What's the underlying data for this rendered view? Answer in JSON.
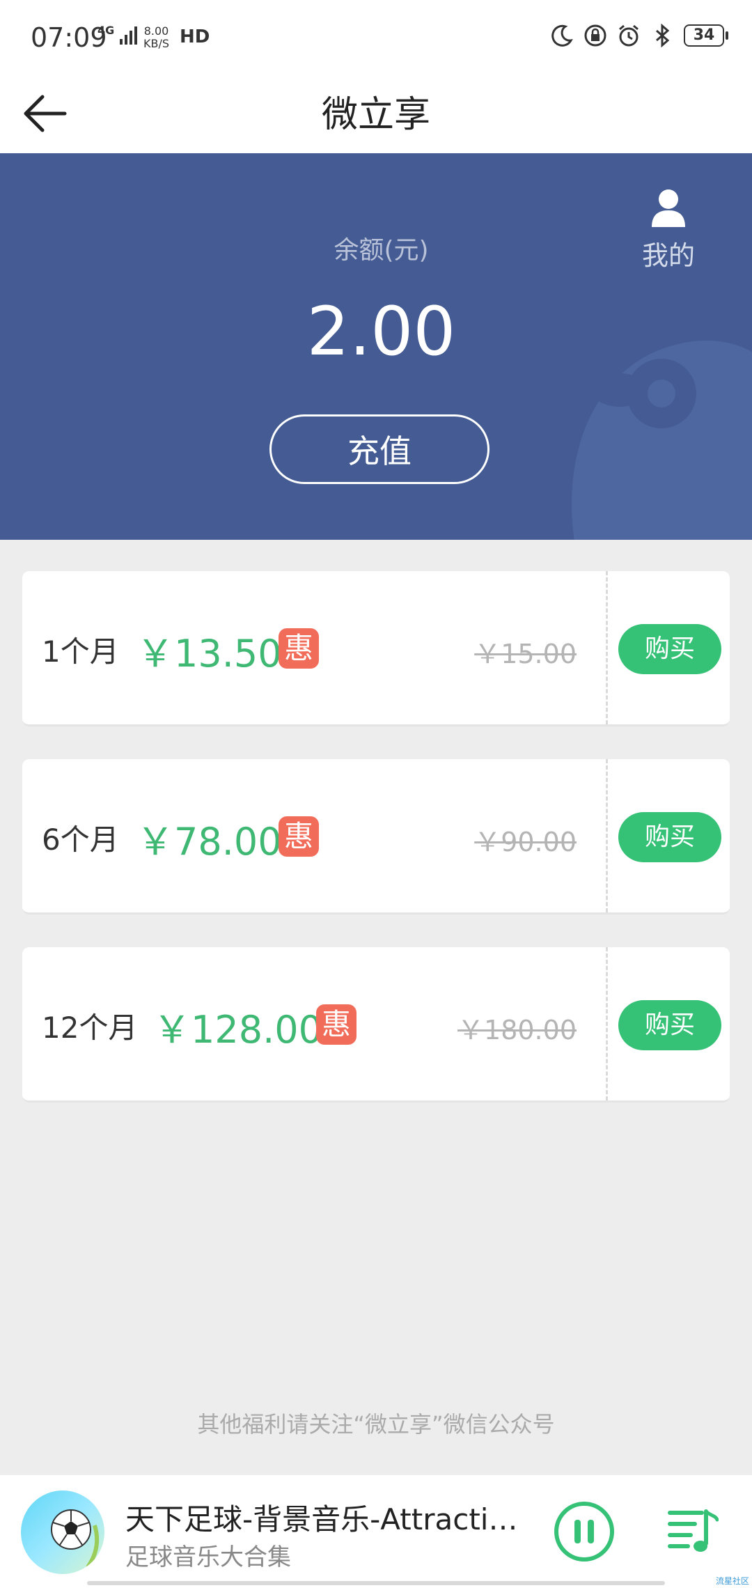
{
  "status_bar": {
    "time": "07:09",
    "network": "4G",
    "speed_value": "8.00",
    "speed_unit": "KB/S",
    "hd": "HD",
    "battery": "34"
  },
  "header": {
    "title": "微立享"
  },
  "balance": {
    "label": "余额(元)",
    "value": "2.00",
    "recharge_label": "充值",
    "my_label": "我的"
  },
  "plans": [
    {
      "duration": "1个月",
      "price": "￥13.50",
      "badge": "惠",
      "original_price": "￥15.00",
      "buy_label": "购买"
    },
    {
      "duration": "6个月",
      "price": "￥78.00",
      "badge": "惠",
      "original_price": "￥90.00",
      "buy_label": "购买"
    },
    {
      "duration": "12个月",
      "price": "￥128.00",
      "badge": "惠",
      "original_price": "￥180.00",
      "buy_label": "购买"
    }
  ],
  "footer_note": "其他福利请关注“微立享”微信公众号",
  "player": {
    "track_title": "天下足球-背景音乐-Attraction...",
    "album": "足球音乐大合集",
    "watermark": "流星社区"
  },
  "colors": {
    "banner": "#445c93",
    "price_green": "#3fb874",
    "buy_button": "#35c176",
    "badge": "#f26c5a"
  }
}
